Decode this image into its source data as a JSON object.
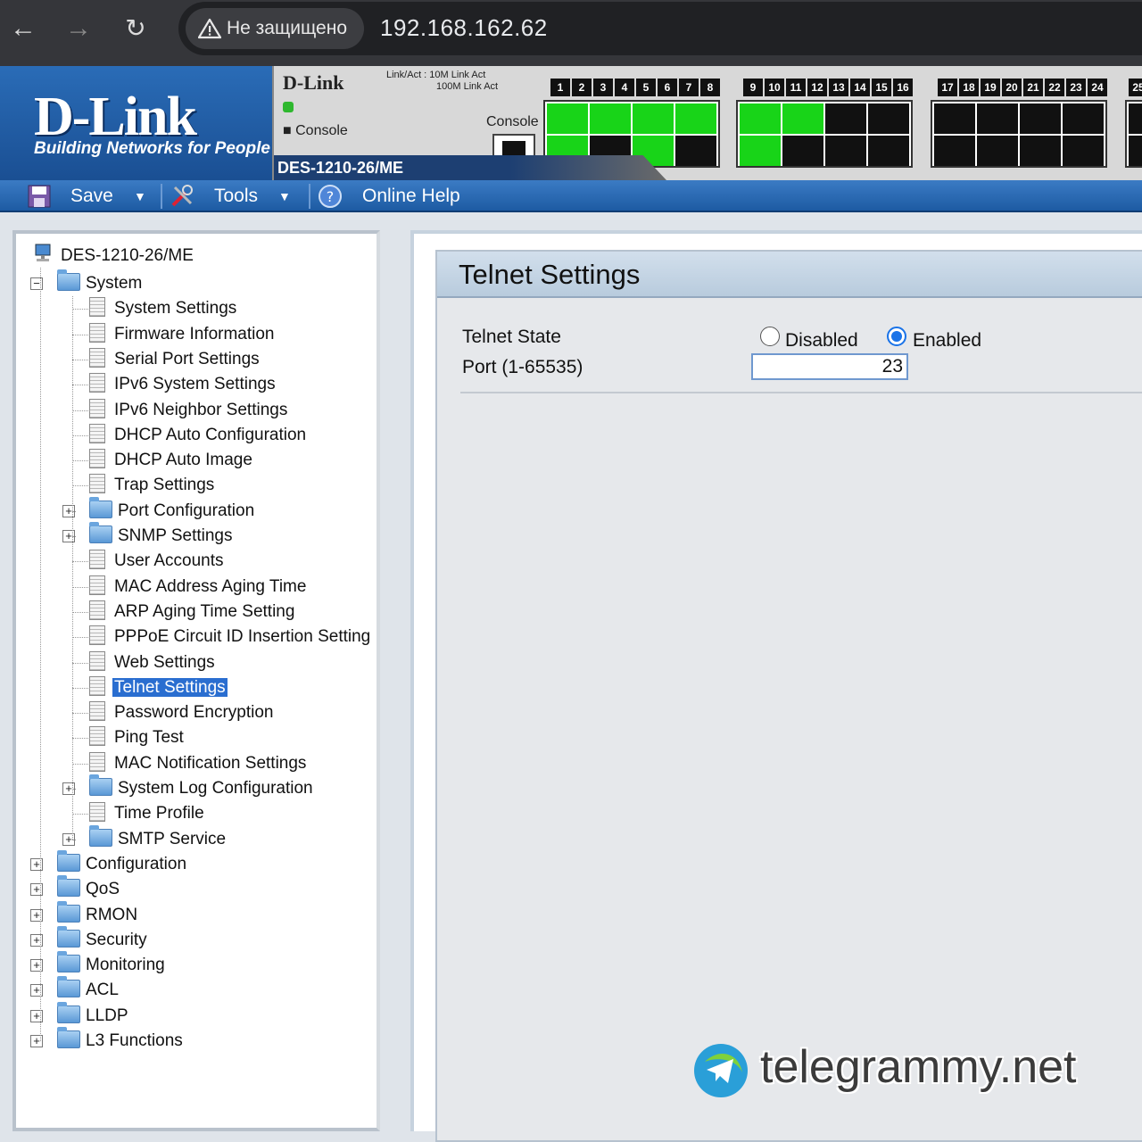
{
  "browser": {
    "security_label": "Не защищено",
    "url": "192.168.162.62"
  },
  "header": {
    "logo_text": "D-Link",
    "tagline": "Building Networks for People",
    "panel_brand": "D-Link",
    "console_label": "Console",
    "console_port_label": "Console",
    "model": "DES-1210-26/ME",
    "legend_line1": "Link/Act : 10M  Link  Act",
    "legend_line2": "100M  Link  Act",
    "port_numbers_a": [
      "1",
      "2",
      "3",
      "4",
      "5",
      "6",
      "7",
      "8"
    ],
    "port_numbers_b": [
      "9",
      "10",
      "11",
      "12",
      "13",
      "14",
      "15",
      "16"
    ],
    "port_numbers_c": [
      "17",
      "18",
      "19",
      "20",
      "21",
      "22",
      "23",
      "24"
    ],
    "port_numbers_d": [
      "25"
    ],
    "port_on_colors": {
      "on": "#18d418",
      "off": "#111111"
    }
  },
  "toolbar": {
    "save_label": "Save",
    "tools_label": "Tools",
    "help_label": "Online Help"
  },
  "tree": {
    "root": "DES-1210-26/ME",
    "system": "System",
    "system_children": [
      "System Settings",
      "Firmware Information",
      "Serial Port Settings",
      "IPv6 System Settings",
      "IPv6 Neighbor Settings",
      "DHCP Auto Configuration",
      "DHCP Auto Image",
      "Trap Settings",
      "Port Configuration",
      "SNMP Settings",
      "User Accounts",
      "MAC Address Aging Time",
      "ARP Aging Time Setting",
      "PPPoE Circuit ID Insertion Setting",
      "Web Settings",
      "Telnet Settings",
      "Password Encryption",
      "Ping Test",
      "MAC Notification Settings",
      "System Log Configuration",
      "Time Profile",
      "SMTP Service"
    ],
    "top_level": [
      "Configuration",
      "QoS",
      "RMON",
      "Security",
      "Monitoring",
      "ACL",
      "LLDP",
      "L3 Functions"
    ],
    "selected": "Telnet Settings"
  },
  "content": {
    "title": "Telnet Settings",
    "telnet_state_label": "Telnet State",
    "disabled_label": "Disabled",
    "enabled_label": "Enabled",
    "telnet_state_value": "Enabled",
    "port_label": "Port (1-65535)",
    "port_value": "23"
  },
  "watermark": {
    "text": "telegrammy.net"
  }
}
